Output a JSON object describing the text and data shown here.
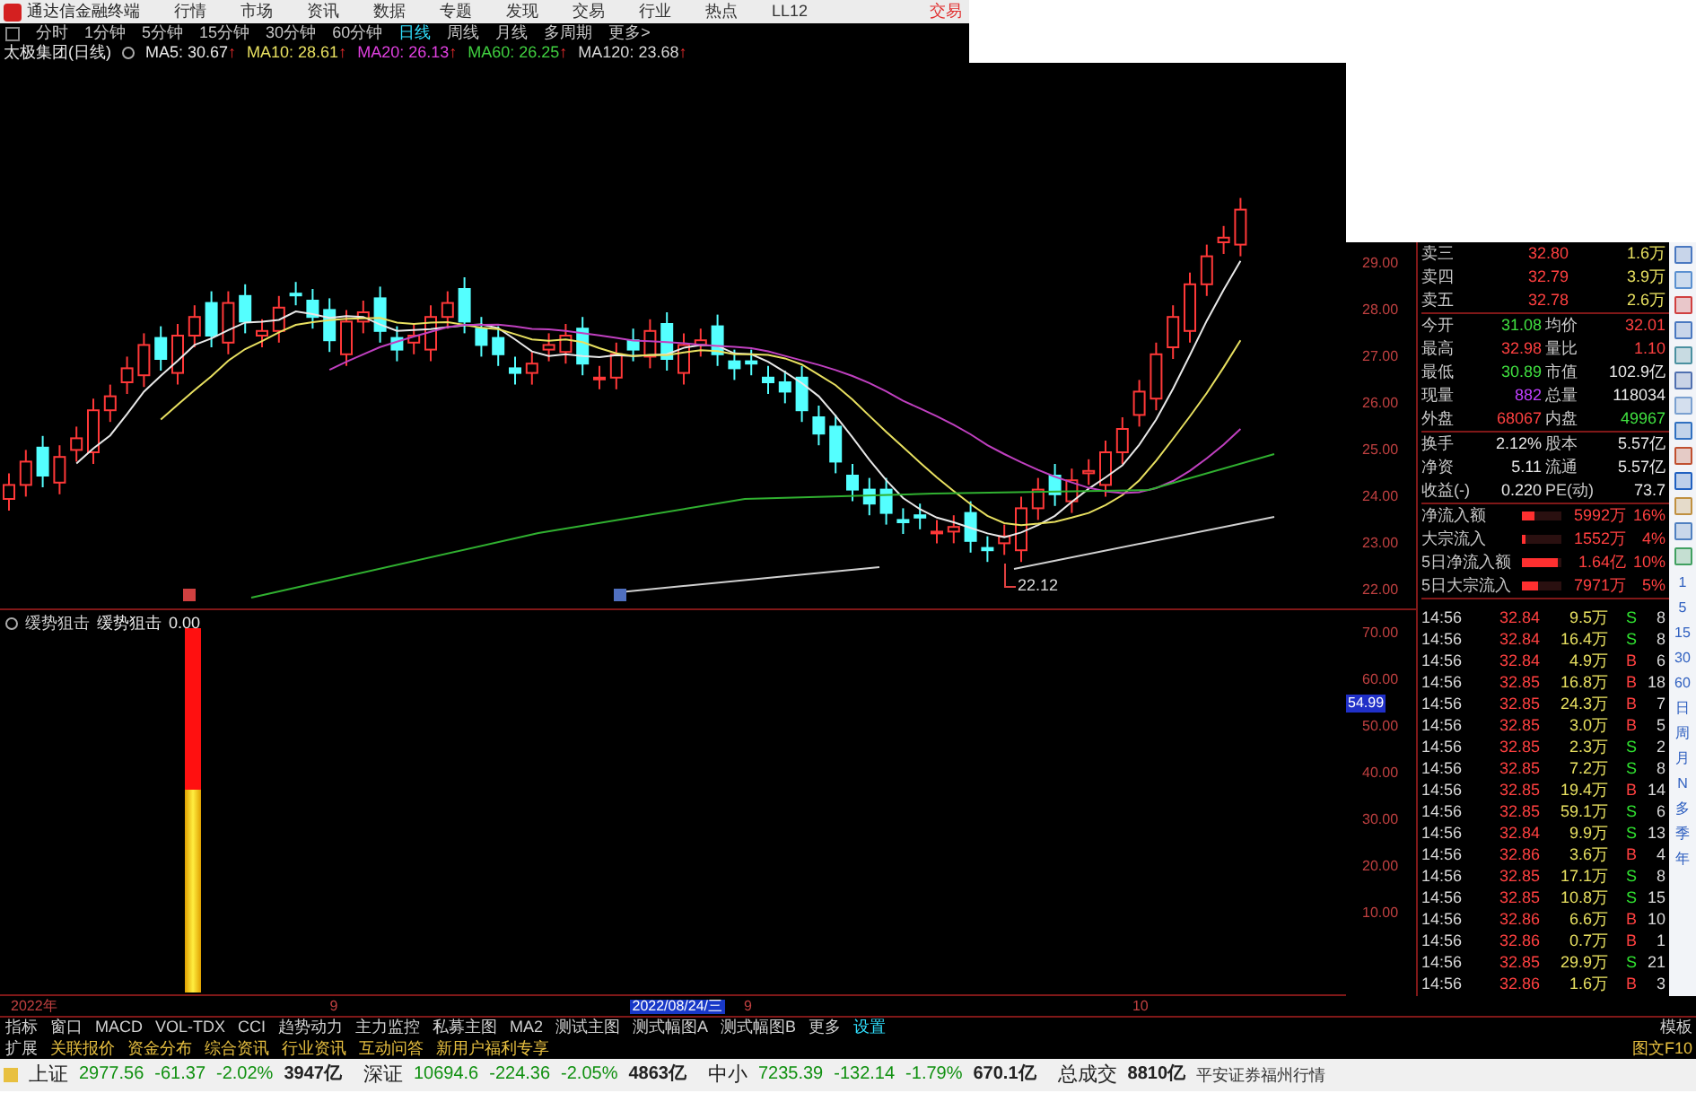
{
  "menu_bar": {
    "app_title": "通达信金融终端",
    "items": [
      "行情",
      "市场",
      "资讯",
      "数据",
      "专题",
      "发现",
      "交易",
      "行业",
      "热点",
      "LL12"
    ],
    "trade_button": "交易"
  },
  "period_bar": {
    "items": [
      {
        "label": "分时",
        "selected": false
      },
      {
        "label": "1分钟",
        "selected": false
      },
      {
        "label": "5分钟",
        "selected": false
      },
      {
        "label": "15分钟",
        "selected": false
      },
      {
        "label": "30分钟",
        "selected": false
      },
      {
        "label": "60分钟",
        "selected": false
      },
      {
        "label": "日线",
        "selected": true
      },
      {
        "label": "周线",
        "selected": false
      },
      {
        "label": "月线",
        "selected": false
      },
      {
        "label": "多周期",
        "selected": false
      },
      {
        "label": "更多>",
        "selected": false
      }
    ]
  },
  "chart_header": {
    "title": "太极集团(日线)",
    "indicators": [
      {
        "label": "MA5: 30.67",
        "trend": "↑",
        "color": "#e8e8e8"
      },
      {
        "label": "MA10: 28.61",
        "trend": "↑",
        "color": "#e8e060"
      },
      {
        "label": "MA20: 26.13",
        "trend": "↑",
        "color": "#e040e0"
      },
      {
        "label": "MA60: 26.25",
        "trend": "↑",
        "color": "#40d040"
      },
      {
        "label": "MA120: 23.68",
        "trend": "↑",
        "color": "#d8d8d8"
      }
    ]
  },
  "price_axis": [
    "29.00",
    "28.00",
    "27.00",
    "26.00",
    "25.00",
    "24.00",
    "23.00",
    "22.00"
  ],
  "low_marker": "22.12",
  "indicator_panel": {
    "name": "缓势狙击",
    "series": "缓势狙击",
    "value": "0.00",
    "axis": [
      "70.00",
      "60.00",
      "50.00",
      "40.00",
      "30.00",
      "20.00",
      "10.00"
    ],
    "cursor_value": "54.99"
  },
  "date_axis": [
    "2022年",
    "9",
    "2022/08/24/三",
    "9",
    "10"
  ],
  "order_book": [
    {
      "label": "卖三",
      "price": "32.80",
      "volume": "1.6万"
    },
    {
      "label": "卖四",
      "price": "32.79",
      "volume": "3.9万"
    },
    {
      "label": "卖五",
      "price": "32.78",
      "volume": "2.6万"
    }
  ],
  "stats": [
    {
      "label": "今开",
      "value": "31.08",
      "color": "#40e040"
    },
    {
      "label": "均价",
      "value": "32.01",
      "color": "#ff4040"
    },
    {
      "label": "最高",
      "value": "32.98",
      "color": "#ff4040"
    },
    {
      "label": "量比",
      "value": "1.10",
      "color": "#ff4040"
    },
    {
      "label": "最低",
      "value": "30.89",
      "color": "#40e040"
    },
    {
      "label": "市值",
      "value": "102.9亿",
      "color": "#e8e8e8"
    },
    {
      "label": "现量",
      "value": "882",
      "color": "#c040ff"
    },
    {
      "label": "总量",
      "value": "118034",
      "color": "#e8e8e8"
    },
    {
      "label": "外盘",
      "value": "68067",
      "color": "#ff4040"
    },
    {
      "label": "内盘",
      "value": "49967",
      "color": "#40e040"
    }
  ],
  "stats2": [
    {
      "label": "换手",
      "value": "2.12%"
    },
    {
      "label": "股本",
      "value": "5.57亿"
    },
    {
      "label": "净资",
      "value": "5.11"
    },
    {
      "label": "流通",
      "value": "5.57亿"
    },
    {
      "label": "收益(-)",
      "value": "0.220"
    },
    {
      "label": "PE(动)",
      "value": "73.7"
    }
  ],
  "fund_flow": [
    {
      "label": "净流入额",
      "value": "5992万",
      "percent": "16%",
      "level": 0.3
    },
    {
      "label": "大宗流入",
      "value": "1552万",
      "percent": "4%",
      "level": 0.1
    },
    {
      "label": "5日净流入额",
      "value": "1.64亿",
      "percent": "10%",
      "level": 0.9
    },
    {
      "label": "5日大宗流入",
      "value": "7971万",
      "percent": "5%",
      "level": 0.4
    }
  ],
  "trades": [
    {
      "time": "14:56",
      "price": "32.84",
      "volume": "9.5万",
      "side": "S",
      "count": "8"
    },
    {
      "time": "14:56",
      "price": "32.84",
      "volume": "16.4万",
      "side": "S",
      "count": "8"
    },
    {
      "time": "14:56",
      "price": "32.84",
      "volume": "4.9万",
      "side": "B",
      "count": "6"
    },
    {
      "time": "14:56",
      "price": "32.85",
      "volume": "16.8万",
      "side": "B",
      "count": "18"
    },
    {
      "time": "14:56",
      "price": "32.85",
      "volume": "24.3万",
      "side": "B",
      "count": "7"
    },
    {
      "time": "14:56",
      "price": "32.85",
      "volume": "3.0万",
      "side": "B",
      "count": "5"
    },
    {
      "time": "14:56",
      "price": "32.85",
      "volume": "2.3万",
      "side": "S",
      "count": "2"
    },
    {
      "time": "14:56",
      "price": "32.85",
      "volume": "7.2万",
      "side": "S",
      "count": "8"
    },
    {
      "time": "14:56",
      "price": "32.85",
      "volume": "19.4万",
      "side": "B",
      "count": "14"
    },
    {
      "time": "14:56",
      "price": "32.85",
      "volume": "59.1万",
      "side": "S",
      "count": "6"
    },
    {
      "time": "14:56",
      "price": "32.84",
      "volume": "9.9万",
      "side": "S",
      "count": "13"
    },
    {
      "time": "14:56",
      "price": "32.86",
      "volume": "3.6万",
      "side": "B",
      "count": "4"
    },
    {
      "time": "14:56",
      "price": "32.85",
      "volume": "17.1万",
      "side": "S",
      "count": "8"
    },
    {
      "time": "14:56",
      "price": "32.85",
      "volume": "10.8万",
      "side": "S",
      "count": "15"
    },
    {
      "time": "14:56",
      "price": "32.86",
      "volume": "6.6万",
      "side": "B",
      "count": "10"
    },
    {
      "time": "14:56",
      "price": "32.86",
      "volume": "0.7万",
      "side": "B",
      "count": "1"
    },
    {
      "time": "14:56",
      "price": "32.85",
      "volume": "29.9万",
      "side": "S",
      "count": "21"
    },
    {
      "time": "14:56",
      "price": "32.86",
      "volume": "1.6万",
      "side": "B",
      "count": "3"
    }
  ],
  "period_shortcuts": [
    "1",
    "5",
    "15",
    "30",
    "60",
    "日",
    "周",
    "月",
    "N",
    "多",
    "季",
    "年"
  ],
  "indicator_tabs": [
    "指标",
    "窗口",
    "MACD",
    "VOL-TDX",
    "CCI",
    "趋势动力",
    "主力监控",
    "私募主图",
    "MA2",
    "测试主图",
    "测式幅图A",
    "测式幅图B",
    "更多",
    "设置"
  ],
  "template_button": "模板",
  "info_tabs": [
    "扩展",
    "关联报价",
    "资金分布",
    "综合资讯",
    "行业资讯",
    "互动问答",
    "新用户福利专享"
  ],
  "f10_button": "图文F10",
  "status_bar": {
    "indices": [
      {
        "name": "上证",
        "value": "2977.56",
        "change": "-61.37",
        "percent": "-2.02%",
        "amount": "3947亿"
      },
      {
        "name": "深证",
        "value": "10694.6",
        "change": "-224.36",
        "percent": "-2.05%",
        "amount": "4863亿"
      },
      {
        "name": "中小",
        "value": "7235.39",
        "change": "-132.14",
        "percent": "-1.79%",
        "amount": "670.1亿"
      }
    ],
    "total_label": "总成交",
    "total": "8810亿",
    "broker": "平安证券福州行情"
  }
}
